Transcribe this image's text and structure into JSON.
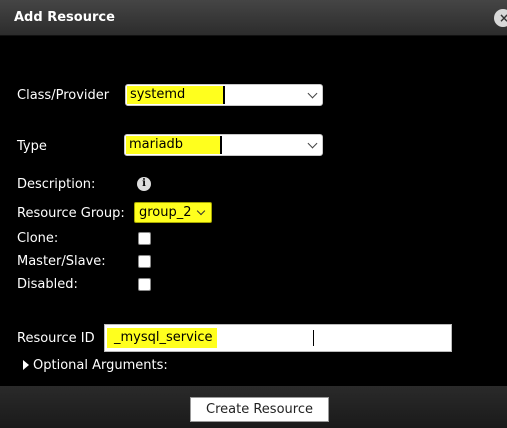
{
  "dialog": {
    "title": "Add Resource",
    "close_icon": "×"
  },
  "form": {
    "class_provider": {
      "label": "Class/Provider",
      "value": "systemd"
    },
    "type": {
      "label": "Type",
      "value": "mariadb"
    },
    "description": {
      "label": "Description:",
      "icon": "info-icon",
      "icon_glyph": "i"
    },
    "resource_group": {
      "label": "Resource Group:",
      "value": "group_2"
    },
    "clone": {
      "label": "Clone:",
      "checked": false
    },
    "master_slave": {
      "label": "Master/Slave:",
      "checked": false
    },
    "disabled": {
      "label": "Disabled:",
      "checked": false
    },
    "resource_id": {
      "label": "Resource ID",
      "value": "_mysql_service"
    },
    "optional_arguments": {
      "label": "Optional Arguments:"
    }
  },
  "footer": {
    "create_label": "Create Resource"
  },
  "colors": {
    "highlight": "#ffff1e",
    "background": "#000000"
  }
}
